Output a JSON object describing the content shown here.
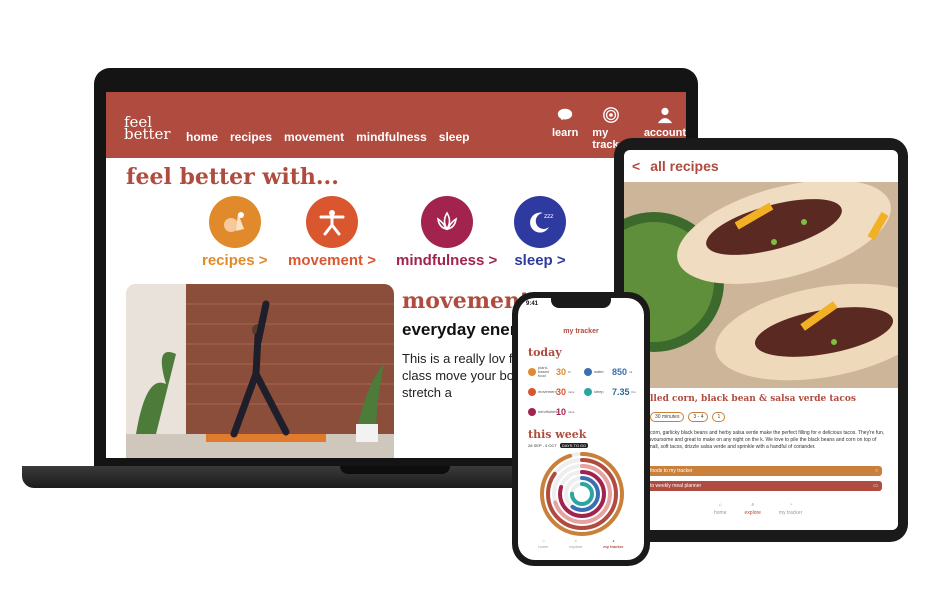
{
  "laptop": {
    "logo_line1": "feel",
    "logo_line2": "better",
    "nav": [
      "home",
      "recipes",
      "movement",
      "mindfulness",
      "sleep"
    ],
    "nav_right": [
      {
        "label": "learn",
        "icon": "brain-icon"
      },
      {
        "label": "my tracker",
        "icon": "tracker-icon"
      },
      {
        "label": "account",
        "icon": "user-icon"
      }
    ],
    "heading": "feel better with...",
    "categories": [
      {
        "label": "recipes >",
        "color": "#e08a2c",
        "icon": "vegetables-icon"
      },
      {
        "label": "movement >",
        "color": "#d9562e",
        "icon": "exercise-figure-icon"
      },
      {
        "label": "mindfulness >",
        "color": "#a3234f",
        "icon": "lotus-icon"
      },
      {
        "label": "sleep >",
        "color": "#2f3aa0",
        "icon": "moon-icon"
      }
    ],
    "feature_title": "movement",
    "feature_subtitle": "everyday energis",
    "feature_body": "This is a really lov for those of us wh classic yoga class move your body a focuses on poses body to stretch a"
  },
  "tablet": {
    "back": "<",
    "title": "all recipes",
    "recipe_title": "lled corn, black bean & salsa verde tacos",
    "tags": [
      "30 minutes",
      "3 - 4",
      "1"
    ],
    "description": "d corn, garlicky black beans and herby salsa verde make the perfect filling for e delicious tacos. They're fun, flavoursome and great to make on any night on the k. We love to pile the black beans and corn on top of small, soft tacos, drizzle salsa verde and sprinkle with a handful of coriander.",
    "btn_tracker": "foods to my tracker",
    "btn_planner": "to weekly meal planner",
    "tabs": [
      {
        "label": "home",
        "active": false
      },
      {
        "label": "explore",
        "active": true
      },
      {
        "label": "my tracker",
        "active": false
      }
    ]
  },
  "phone": {
    "time": "9:41",
    "title": "my tracker",
    "today_label": "today",
    "stats": [
      {
        "label": "plant-based food",
        "value": "30",
        "unit": "%",
        "color": "#e08a2c"
      },
      {
        "label": "water",
        "value": "850",
        "unit": "ml",
        "color": "#3b6fb3"
      },
      {
        "label": "movement",
        "value": "30",
        "unit": "mins",
        "color": "#d9562e"
      },
      {
        "label": "sleep",
        "value": "7.35",
        "unit": "hrs",
        "color": "#2aa6a0"
      },
      {
        "label": "mindfulness",
        "value": "10",
        "unit": "mins",
        "color": "#a3234f"
      }
    ],
    "week_label": "this week",
    "week_range": "28 SEP - 4 OCT",
    "week_badge": "DAYS TO GO",
    "rings": [
      {
        "color": "#c9803a",
        "fraction": 0.95
      },
      {
        "color": "#b04c3f",
        "fraction": 0.85
      },
      {
        "color": "#e6a2a0",
        "fraction": 0.7
      },
      {
        "color": "#a3234f",
        "fraction": 0.8
      },
      {
        "color": "#3b6fb3",
        "fraction": 0.6
      },
      {
        "color": "#2aa6a0",
        "fraction": 0.75
      }
    ],
    "tabs": [
      {
        "label": "home",
        "active": false
      },
      {
        "label": "explore",
        "active": false
      },
      {
        "label": "my tracker",
        "active": true
      }
    ]
  }
}
